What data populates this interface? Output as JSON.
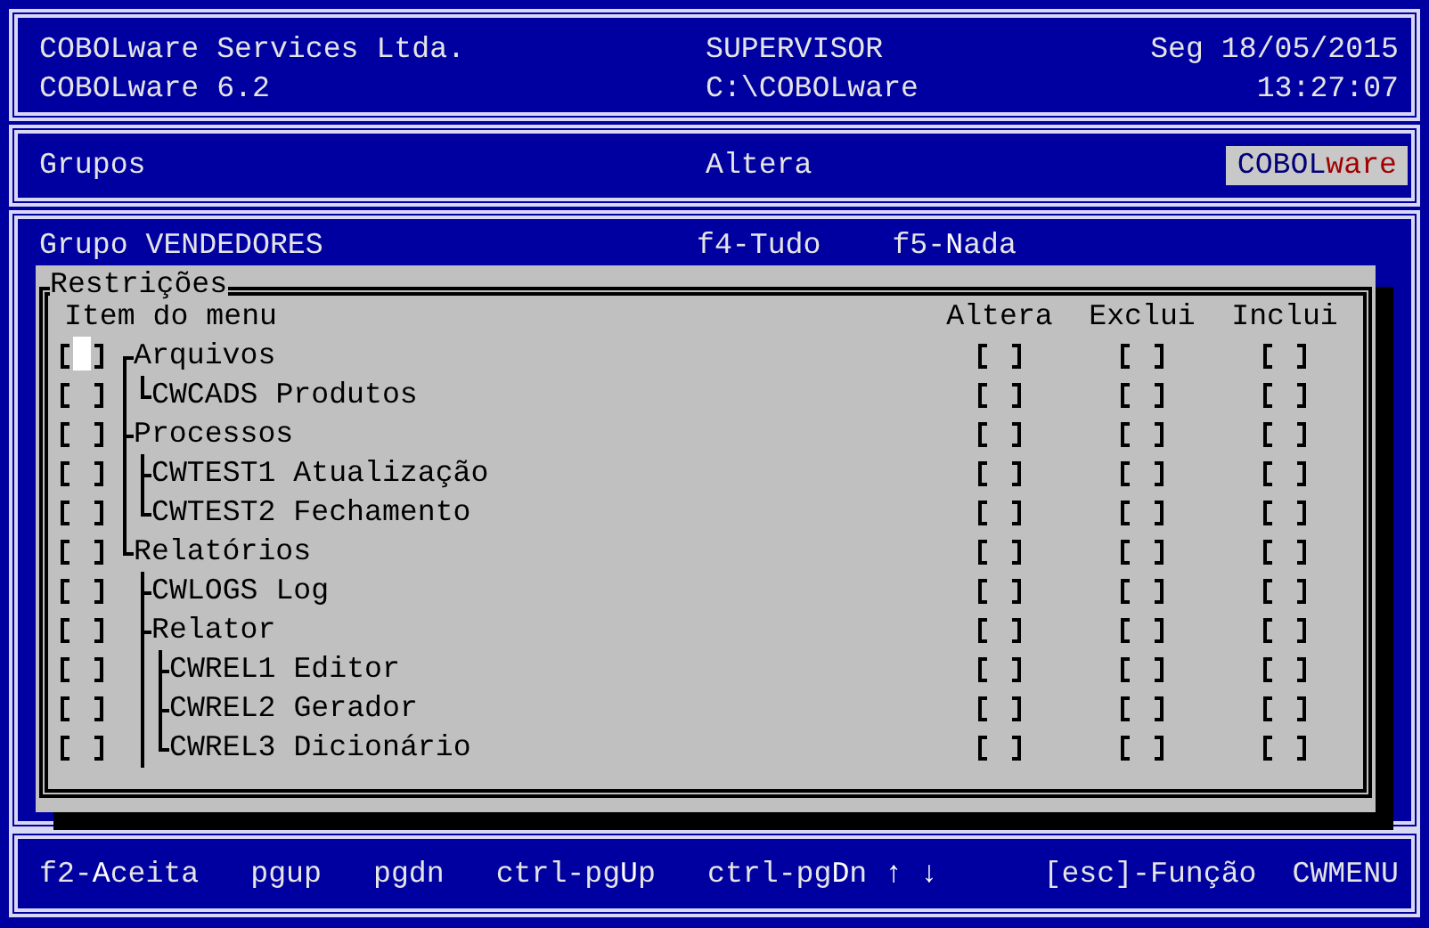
{
  "header": {
    "company": "COBOLware Services Ltda.",
    "version": "COBOLware 6.2",
    "user": "SUPERVISOR",
    "path": "C:\\COBOLware",
    "date": "Seg 18/05/2015",
    "time": "13:27:07"
  },
  "titlebar": {
    "module": "Grupos",
    "action": "Altera",
    "logo": "COBOL**ware**"
  },
  "group": {
    "label": "Grupo VENDEDORES",
    "keys": [
      "f4-Tudo",
      "f5-**N**ada"
    ]
  },
  "dialog": {
    "title": "Restrições",
    "columns": [
      "Item do menu",
      "Altera",
      "Exclui",
      "Inclui"
    ],
    "items": [
      {
        "label": "Arquivos",
        "kind": "first",
        "checked": false,
        "focused": true,
        "altera": false,
        "exclui": false,
        "inclui": false,
        "children": [
          {
            "label": "CWCADS Produtos",
            "kind": "last",
            "checked": false,
            "focused": false,
            "altera": false,
            "exclui": false,
            "inclui": false
          }
        ]
      },
      {
        "label": "Processos",
        "kind": "middle",
        "checked": false,
        "focused": false,
        "altera": false,
        "exclui": false,
        "inclui": false,
        "children": [
          {
            "label": "CWTEST1 Atualização",
            "kind": "middle",
            "checked": false,
            "focused": false,
            "altera": false,
            "exclui": false,
            "inclui": false
          },
          {
            "label": "CWTEST2 Fechamento",
            "kind": "last",
            "checked": false,
            "focused": false,
            "altera": false,
            "exclui": false,
            "inclui": false
          }
        ]
      },
      {
        "label": "Relatórios",
        "kind": "last",
        "checked": false,
        "focused": false,
        "altera": false,
        "exclui": false,
        "inclui": false,
        "children": [
          {
            "label": "CWLOGS Log",
            "kind": "middle",
            "checked": false,
            "focused": false,
            "altera": false,
            "exclui": false,
            "inclui": false
          },
          {
            "label": "Relator",
            "kind": "middle",
            "checked": false,
            "focused": false,
            "altera": false,
            "exclui": false,
            "inclui": false,
            "children": [
              {
                "label": "CWREL1 Editor",
                "kind": "middle",
                "checked": false,
                "focused": false,
                "altera": false,
                "exclui": false,
                "inclui": false
              },
              {
                "label": "CWREL2 Gerador",
                "kind": "middle",
                "checked": false,
                "focused": false,
                "altera": false,
                "exclui": false,
                "inclui": false
              },
              {
                "label": "CWREL3 Dicionário",
                "kind": "last",
                "checked": false,
                "focused": false,
                "altera": false,
                "exclui": false,
                "inclui": false
              }
            ]
          }
        ]
      }
    ]
  },
  "footer": {
    "keys": [
      "f2-**A**ceita",
      "pgup",
      "pgdn",
      "ctrl-pg**U**p",
      "ctrl-pg**D**n"
    ],
    "arrows": "↑ ↓",
    "escape": "[esc]-Função",
    "menu": "CWMENU"
  }
}
